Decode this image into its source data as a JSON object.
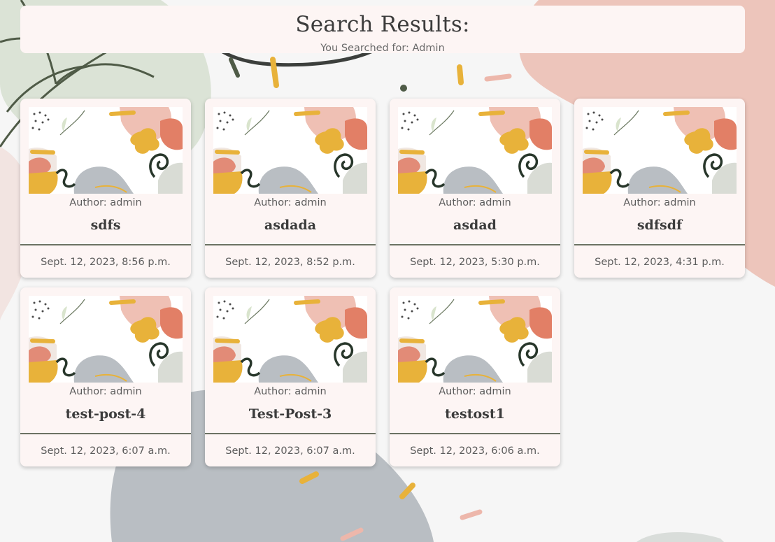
{
  "header": {
    "title": "Search Results:",
    "subtitle": "You Searched for: Admin"
  },
  "posts": [
    {
      "author": "Author: admin",
      "title": "sdfs",
      "date": "Sept. 12, 2023, 8:56 p.m."
    },
    {
      "author": "Author: admin",
      "title": "asdada",
      "date": "Sept. 12, 2023, 8:52 p.m."
    },
    {
      "author": "Author: admin",
      "title": "asdad",
      "date": "Sept. 12, 2023, 5:30 p.m."
    },
    {
      "author": "Author: admin",
      "title": "sdfsdf",
      "date": "Sept. 12, 2023, 4:31 p.m."
    },
    {
      "author": "Author: admin",
      "title": "test-post-4",
      "date": "Sept. 12, 2023, 6:07 a.m."
    },
    {
      "author": "Author: admin",
      "title": "Test-Post-3",
      "date": "Sept. 12, 2023, 6:07 a.m."
    },
    {
      "author": "Author: admin",
      "title": "testost1",
      "date": "Sept. 12, 2023, 6:06 a.m."
    }
  ],
  "colors": {
    "card_bg": "#fdf5f4",
    "divider": "#6c7263",
    "accent_mustard": "#e8b23a",
    "accent_pink": "#edc5bb",
    "accent_sage": "#dbe3d6",
    "accent_gray": "#b9bec3",
    "leaf_green": "#4f5b47"
  }
}
